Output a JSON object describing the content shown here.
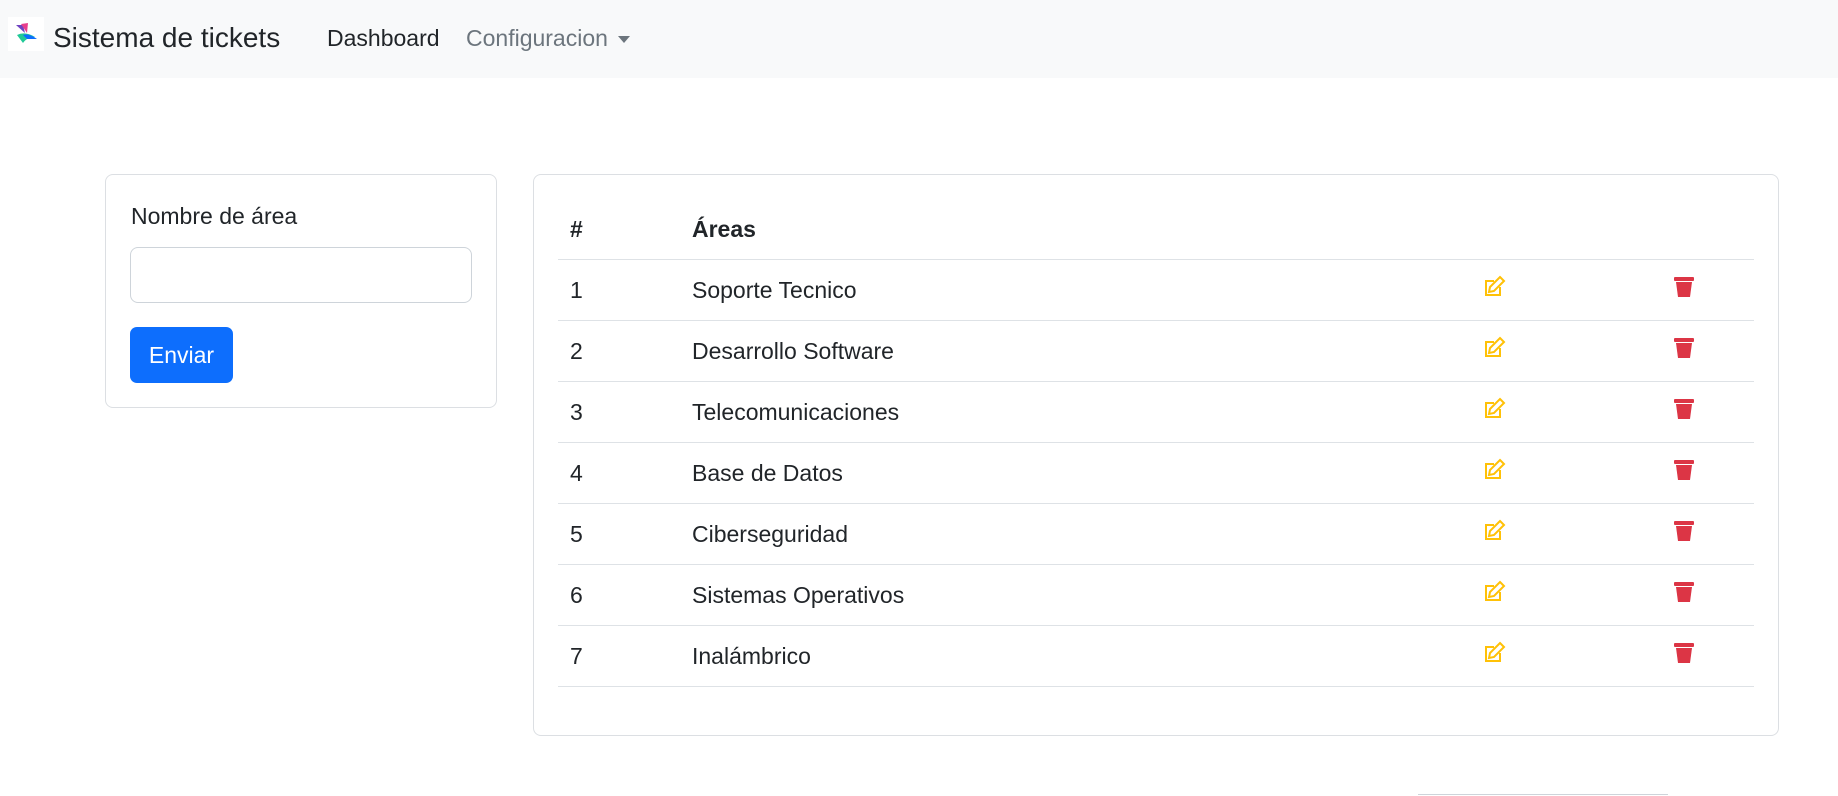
{
  "navbar": {
    "brand_title": "Sistema de tickets",
    "links": [
      {
        "label": "Dashboard"
      },
      {
        "label": "Configuracion"
      }
    ]
  },
  "form": {
    "label": "Nombre de área",
    "input_value": "",
    "submit_label": "Enviar"
  },
  "table": {
    "headers": [
      "#",
      "Áreas"
    ],
    "rows": [
      {
        "num": "1",
        "name": "Soporte Tecnico"
      },
      {
        "num": "2",
        "name": "Desarrollo Software"
      },
      {
        "num": "3",
        "name": "Telecomunicaciones"
      },
      {
        "num": "4",
        "name": "Base de Datos"
      },
      {
        "num": "5",
        "name": "Ciberseguridad"
      },
      {
        "num": "6",
        "name": "Sistemas Operativos"
      },
      {
        "num": "7",
        "name": "Inalámbrico"
      }
    ],
    "row_icons": {
      "edit": "edit-icon",
      "delete": "trash-icon"
    }
  },
  "colors": {
    "primary": "#0d6efd",
    "edit": "#ffc107",
    "delete": "#dc3545",
    "navbar_bg": "#f8f9fa"
  }
}
